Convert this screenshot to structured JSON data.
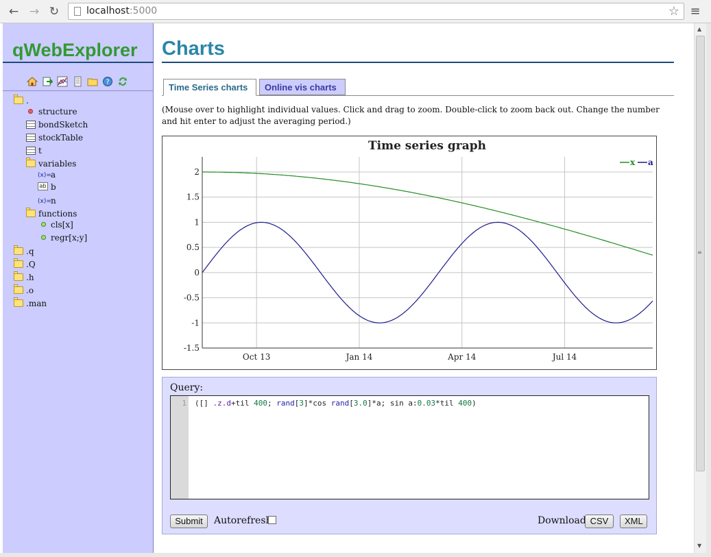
{
  "browser": {
    "url_host": "localhost",
    "url_port": ":5000"
  },
  "sidebar": {
    "logo": "qWebExplorer",
    "toolbar_icons": [
      "home-icon",
      "export-icon",
      "chart-icon",
      "document-icon",
      "folder-icon",
      "help-icon",
      "refresh-icon"
    ],
    "tree": {
      "root": ".",
      "structure": "structure",
      "bondSketch": "bondSketch",
      "stockTable": "stockTable",
      "t": "t",
      "variables": "variables",
      "var_a": "a",
      "var_b": "b",
      "var_n": "n",
      "functions": "functions",
      "fn_cls": "cls[x]",
      "fn_regr": "regr[x;y]",
      "ns_q": ".q",
      "ns_Q": ".Q",
      "ns_h": ".h",
      "ns_o": ".o",
      "ns_man": ".man"
    }
  },
  "main": {
    "title": "Charts",
    "tabs": [
      "Time Series charts",
      "Online vis charts"
    ],
    "help_text": "(Mouse over to highlight individual values. Click and drag to zoom. Double-click to zoom back out. Change the number and hit enter to adjust the averaging period.)",
    "query": {
      "label": "Query:",
      "line_number": "1",
      "code": "([] .z.d+til 400; rand[3]*cos rand[3.0]*a; sin a:0.03*til 400)",
      "submit_label": "Submit",
      "autorefresh_label": "Autorefresh",
      "download_label": "Download",
      "csv_label": "CSV",
      "xml_label": "XML"
    }
  },
  "chart_data": {
    "type": "line",
    "title": "Time series graph",
    "x_tick_labels": [
      "Oct 13",
      "Jan 14",
      "Apr 14",
      "Jul 14"
    ],
    "y_tick_labels": [
      "2",
      "1.5",
      "1",
      "0.5",
      "0",
      "-0.5",
      "-1",
      "-1.5"
    ],
    "ylim": [
      -1.5,
      2.3
    ],
    "grid": true,
    "legend": "top-right",
    "series": [
      {
        "name": "x",
        "color": "#228b22",
        "amplitude": 2.0,
        "frequency": 0.0035,
        "shape": "cos"
      },
      {
        "name": "a",
        "color": "#1a1a8c",
        "amplitude": 1.0,
        "frequency": 0.03,
        "shape": "sin"
      }
    ],
    "n_points": 400
  }
}
